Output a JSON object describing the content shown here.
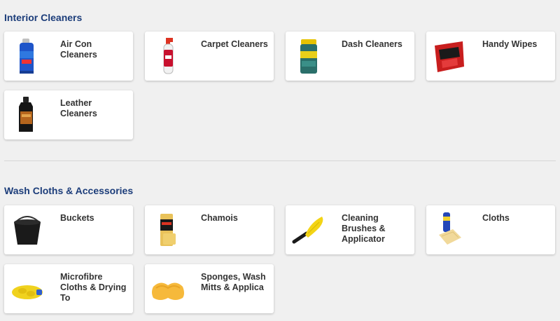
{
  "sections": [
    {
      "title": "Interior Cleaners",
      "items": [
        {
          "label": "Air Con Cleaners",
          "icon": "aerosol-can-icon"
        },
        {
          "label": "Carpet Cleaners",
          "icon": "spray-bottle-icon"
        },
        {
          "label": "Dash Cleaners",
          "icon": "wipes-canister-icon"
        },
        {
          "label": "Handy Wipes",
          "icon": "wipes-pack-icon"
        },
        {
          "label": "Leather Cleaners",
          "icon": "leather-bottle-icon"
        }
      ]
    },
    {
      "title": "Wash Cloths & Accessories",
      "items": [
        {
          "label": "Buckets",
          "icon": "bucket-icon"
        },
        {
          "label": "Chamois",
          "icon": "chamois-icon"
        },
        {
          "label": "Cleaning Brushes & Applicator",
          "icon": "brush-icon"
        },
        {
          "label": "Cloths",
          "icon": "cloth-icon"
        },
        {
          "label": "Microfibre Cloths & Drying To",
          "icon": "wash-mitt-icon"
        },
        {
          "label": "Sponges, Wash Mitts & Applica",
          "icon": "sponge-icon"
        }
      ]
    }
  ]
}
